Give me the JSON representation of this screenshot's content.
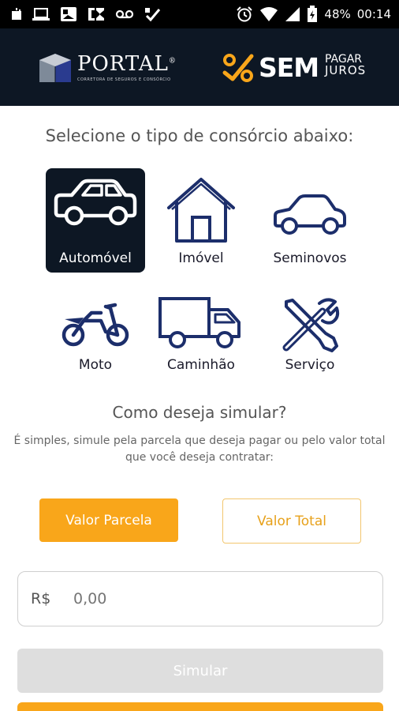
{
  "status_bar": {
    "battery": "48%",
    "time": "00:14"
  },
  "header": {
    "portal_logo": {
      "word": "PORTAL",
      "registered_mark": "®",
      "tagline": "CORRETORA DE SEGUROS E CONSÓRCIO"
    },
    "sem_logo": {
      "word": "SEM",
      "top_word": "PAGAR",
      "bottom_word": "JUROS"
    }
  },
  "consortium": {
    "title": "Selecione o tipo de consórcio abaixo:",
    "options": [
      {
        "label": "Automóvel",
        "icon": "car-icon",
        "selected": true
      },
      {
        "label": "Imóvel",
        "icon": "house-icon",
        "selected": false
      },
      {
        "label": "Seminovos",
        "icon": "compact-car-icon",
        "selected": false
      },
      {
        "label": "Moto",
        "icon": "motorcycle-icon",
        "selected": false
      },
      {
        "label": "Caminhão",
        "icon": "truck-icon",
        "selected": false
      },
      {
        "label": "Serviço",
        "icon": "tools-icon",
        "selected": false
      }
    ]
  },
  "simulation": {
    "title": "Como deseja simular?",
    "description": "É simples, simule pela parcela que deseja pagar ou pelo valor total que você deseja contratar:",
    "mode_buttons": {
      "installment_label": "Valor Parcela",
      "total_label": "Valor Total",
      "active": "Valor Parcela"
    },
    "currency": "R$",
    "value_placeholder": "0,00",
    "submit_label": "Simular"
  },
  "colors": {
    "header_bg": "#0d1724",
    "accent_orange": "#f9a61a",
    "icon_navy": "#1c2e6b",
    "disabled_gray": "#dedede"
  }
}
